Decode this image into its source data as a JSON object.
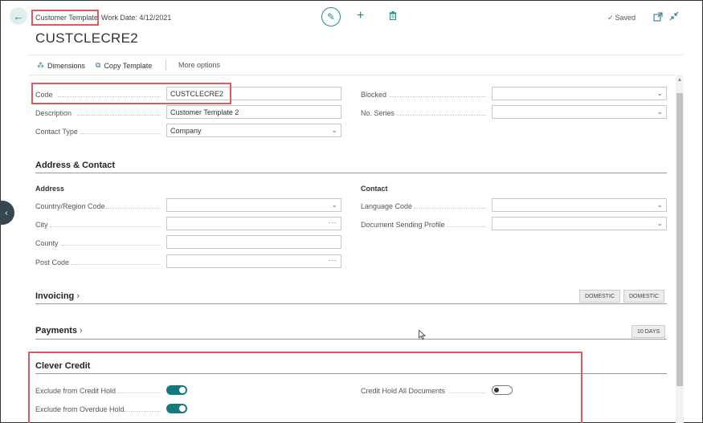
{
  "header": {
    "caption": "Customer Template",
    "work_date": "Work Date: 4/12/2021",
    "title": "CUSTCLECRE2",
    "saved": "Saved"
  },
  "icons": {
    "back": "back-arrow-icon",
    "edit": "pencil-icon",
    "new": "plus-icon",
    "delete": "trash-icon",
    "saved": "checkmark-icon",
    "popout": "popout-icon",
    "collapse": "collapse-icon"
  },
  "actions": {
    "dimensions": "Dimensions",
    "copy_template": "Copy Template",
    "more_options": "More options"
  },
  "general": {
    "code_label": "Code",
    "code_value": "CUSTCLECRE2",
    "description_label": "Description",
    "description_value": "Customer Template 2",
    "contact_type_label": "Contact Type",
    "contact_type_value": "Company",
    "blocked_label": "Blocked",
    "blocked_value": "",
    "no_series_label": "No. Series",
    "no_series_value": ""
  },
  "address_contact": {
    "title": "Address & Contact",
    "address_heading": "Address",
    "contact_heading": "Contact",
    "country_label": "Country/Region Code",
    "city_label": "City",
    "county_label": "County",
    "post_code_label": "Post Code",
    "language_label": "Language Code",
    "doc_sending_label": "Document Sending Profile"
  },
  "invoicing": {
    "title": "Invoicing",
    "tag1": "DOMESTIC",
    "tag2": "DOMESTIC"
  },
  "payments": {
    "title": "Payments",
    "tag": "10 DAYS"
  },
  "clever_credit": {
    "title": "Clever Credit",
    "exclude_credit_hold_label": "Exclude from Credit Hold",
    "exclude_credit_hold": true,
    "exclude_overdue_hold_label": "Exclude from Overdue Hold",
    "exclude_overdue_hold": true,
    "credit_hold_all_docs_label": "Credit Hold All Documents",
    "credit_hold_all_docs": false
  },
  "colors": {
    "accent": "#1e8a93",
    "toggle_on": "#147a82",
    "highlight": "#e0595f"
  }
}
